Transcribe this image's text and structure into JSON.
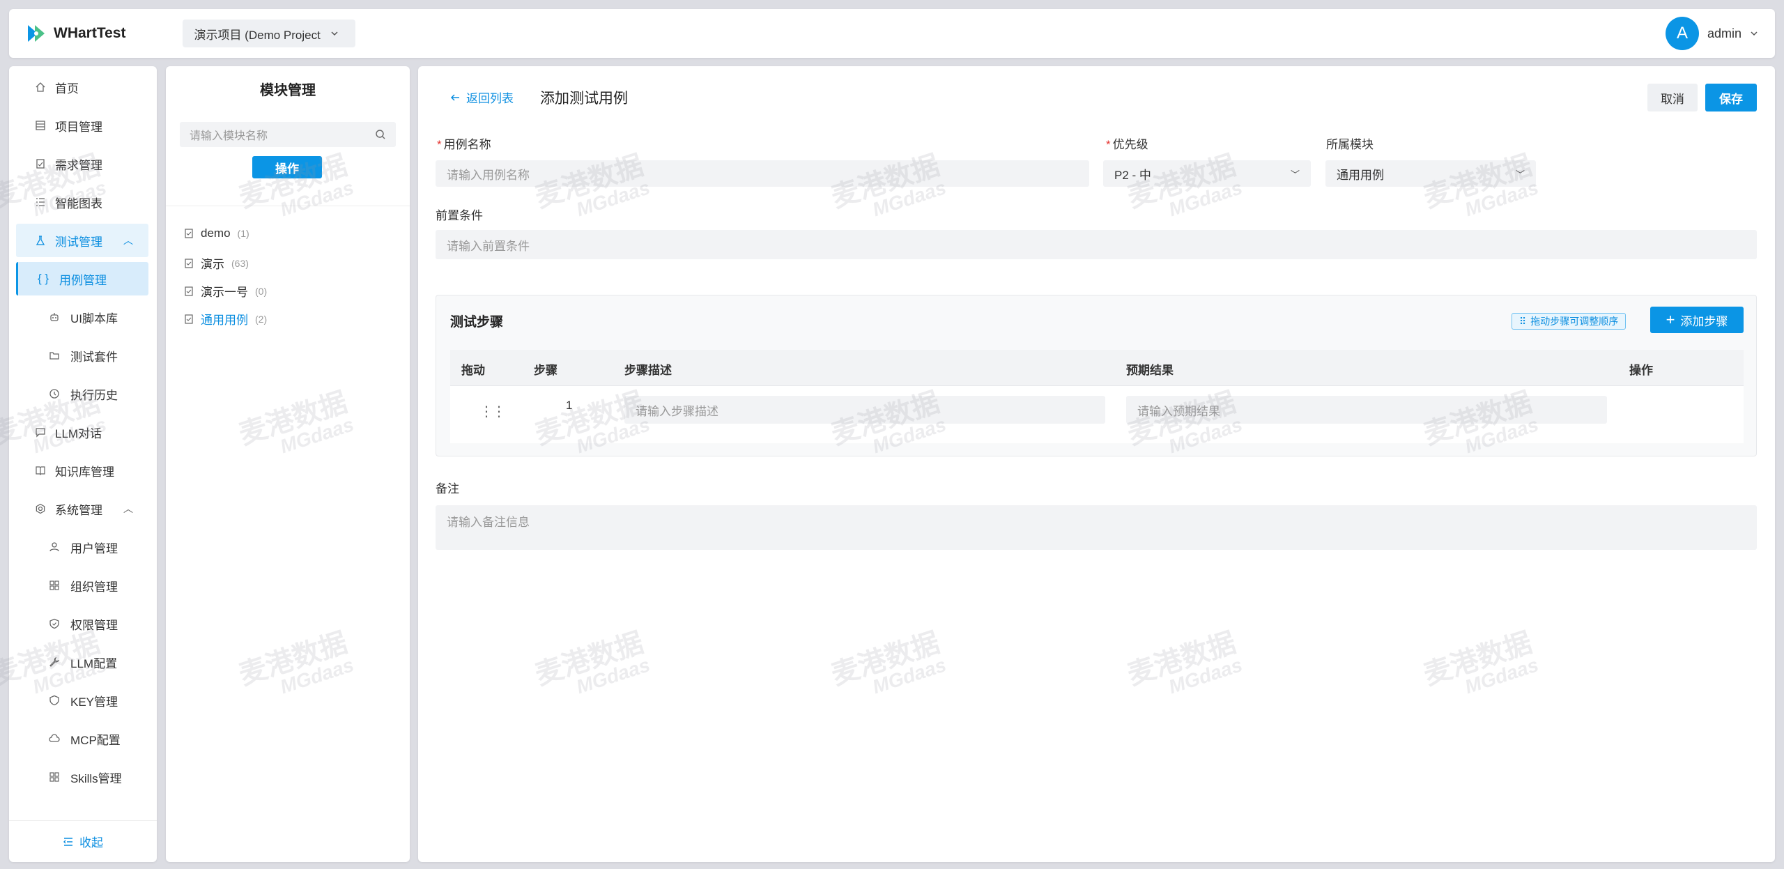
{
  "header": {
    "app_name": "WHartTest",
    "project": "演示项目 (Demo Project",
    "user_initial": "A",
    "user_name": "admin"
  },
  "sidebar": {
    "items": [
      {
        "label": "首页",
        "icon": "home-icon"
      },
      {
        "label": "项目管理",
        "icon": "project-icon"
      },
      {
        "label": "需求管理",
        "icon": "requirement-icon"
      },
      {
        "label": "智能图表",
        "icon": "chart-icon"
      },
      {
        "label": "测试管理",
        "icon": "flask-icon",
        "open": true
      },
      {
        "label": "用例管理",
        "icon": "braces-icon",
        "active": true
      },
      {
        "label": "UI脚本库",
        "icon": "robot-icon"
      },
      {
        "label": "测试套件",
        "icon": "folder-icon"
      },
      {
        "label": "执行历史",
        "icon": "history-icon"
      },
      {
        "label": "LLM对话",
        "icon": "chat-icon"
      },
      {
        "label": "知识库管理",
        "icon": "book-icon"
      },
      {
        "label": "系统管理",
        "icon": "gear-icon"
      },
      {
        "label": "用户管理",
        "icon": "user-icon"
      },
      {
        "label": "组织管理",
        "icon": "grid-icon"
      },
      {
        "label": "权限管理",
        "icon": "shield-icon"
      },
      {
        "label": "LLM配置",
        "icon": "wrench-icon"
      },
      {
        "label": "KEY管理",
        "icon": "key-shield-icon"
      },
      {
        "label": "MCP配置",
        "icon": "cloud-icon"
      },
      {
        "label": "Skills管理",
        "icon": "apps-icon"
      }
    ],
    "collapse_label": "收起"
  },
  "modules": {
    "title": "模块管理",
    "search_placeholder": "请输入模块名称",
    "operate_label": "操作",
    "tree": [
      {
        "label": "demo",
        "count": "(1)"
      },
      {
        "label": "演示",
        "count": "(63)"
      },
      {
        "label": "演示一号",
        "count": "(0)"
      },
      {
        "label": "通用用例",
        "count": "(2)",
        "selected": true
      }
    ]
  },
  "main": {
    "back_label": "返回列表",
    "title": "添加测试用例",
    "cancel_label": "取消",
    "save_label": "保存",
    "case_name_label": "用例名称",
    "case_name_placeholder": "请输入用例名称",
    "priority_label": "优先级",
    "priority_value": "P2 - 中",
    "module_label": "所属模块",
    "module_value": "通用用例",
    "precondition_label": "前置条件",
    "precondition_placeholder": "请输入前置条件",
    "steps_title": "测试步骤",
    "drag_hint": "拖动步骤可调整顺序",
    "add_step_label": "添加步骤",
    "columns": {
      "drag": "拖动",
      "step": "步骤",
      "desc": "步骤描述",
      "expected": "预期结果",
      "ops": "操作"
    },
    "row": {
      "step": "1",
      "desc_placeholder": "请输入步骤描述",
      "expected_placeholder": "请输入预期结果"
    },
    "notes_label": "备注",
    "notes_placeholder": "请输入备注信息"
  },
  "watermark": {
    "line1": "麦港数据",
    "line2": "MGdaas"
  },
  "colors": {
    "accent": "#0b95e5",
    "required": "#e53935"
  }
}
